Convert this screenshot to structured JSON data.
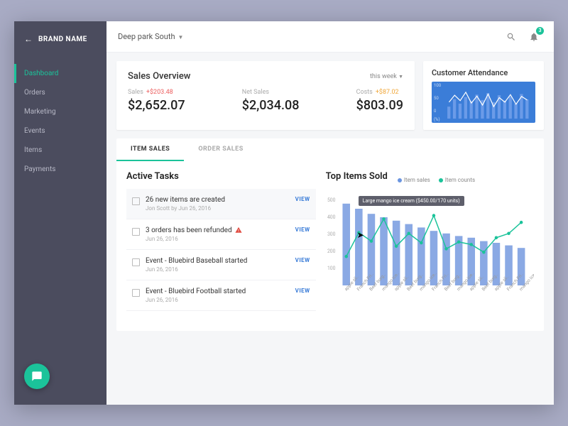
{
  "brand": "BRAND NAME",
  "location": "Deep park South",
  "notification_count": "3",
  "sidebar": {
    "items": [
      {
        "label": "Dashboard",
        "active": true
      },
      {
        "label": "Orders"
      },
      {
        "label": "Marketing"
      },
      {
        "label": "Events"
      },
      {
        "label": "Items"
      },
      {
        "label": "Payments"
      }
    ]
  },
  "sales_overview": {
    "title": "Sales Overview",
    "period": "this week",
    "metrics": [
      {
        "label": "Sales",
        "delta": "+$203.48",
        "delta_class": "neg",
        "value": "$2,652.07"
      },
      {
        "label": "Net Sales",
        "delta": "",
        "value": "$2,034.08"
      },
      {
        "label": "Costs",
        "delta": "+$87.02",
        "delta_class": "pos",
        "value": "$803.09"
      }
    ]
  },
  "attendance": {
    "title": "Customer Attendance",
    "y": [
      "100",
      "50",
      "0",
      "(%)"
    ]
  },
  "tabs": [
    {
      "label": "ITEM SALES",
      "active": true
    },
    {
      "label": "ORDER SALES"
    }
  ],
  "tasks": {
    "title": "Active Tasks",
    "items": [
      {
        "title": "26 new items are created",
        "meta": "Jon Scott by Jun 26, 2016",
        "view": "VIEW"
      },
      {
        "title": "3 orders has been refunded",
        "meta": "Jun 26, 2016",
        "view": "VIEW",
        "alert": true
      },
      {
        "title": "Event - Bluebird Baseball started",
        "meta": "Jun 26, 2016",
        "view": "VIEW"
      },
      {
        "title": "Event - Bluebird Football started",
        "meta": "Jun 26, 2016",
        "view": "VIEW"
      }
    ]
  },
  "top_items": {
    "title": "Top Items Sold",
    "legend": [
      "Item sales",
      "Item counts"
    ],
    "tooltip": "Large mango ice cream ($450.00/170 units)"
  },
  "chart_data": {
    "type": "bar+line",
    "ylim": [
      0,
      500
    ],
    "yticks": [
      500,
      400,
      300,
      200,
      100
    ],
    "categories": [
      "apple sli..",
      "Franch Fri..",
      "Beef burg..",
      "mango ice..",
      "apple sli..",
      "Beef burg..",
      "mango ice..",
      "Franch Fri..",
      "Beef burg..",
      "mango ice..",
      "apple sli..",
      "Beef burg..",
      "apple sli..",
      "Franch Fri..",
      "mango ice.."
    ],
    "series": [
      {
        "name": "Item sales",
        "type": "bar",
        "values": [
          480,
          450,
          420,
          400,
          380,
          360,
          340,
          320,
          305,
          290,
          280,
          260,
          250,
          235,
          220
        ]
      },
      {
        "name": "Item counts",
        "type": "line",
        "values": [
          170,
          310,
          260,
          390,
          230,
          305,
          250,
          410,
          215,
          255,
          240,
          195,
          280,
          305,
          370
        ]
      }
    ],
    "attendance": {
      "type": "line+bars",
      "x": 15,
      "bars": [
        40,
        65,
        50,
        72,
        58,
        80,
        62,
        85,
        55,
        78,
        60,
        75,
        50,
        82,
        64
      ],
      "line": [
        55,
        78,
        60,
        88,
        52,
        75,
        45,
        82,
        40,
        70,
        55,
        80,
        48,
        74,
        62
      ]
    }
  }
}
